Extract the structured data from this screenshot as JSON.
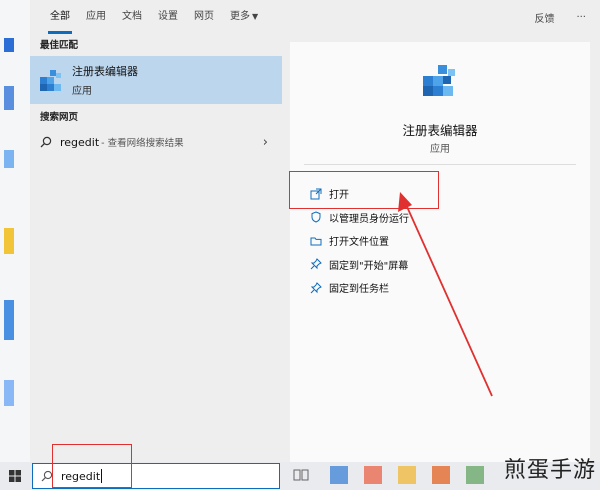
{
  "tabs": [
    {
      "label": "全部",
      "active": true
    },
    {
      "label": "应用"
    },
    {
      "label": "文档"
    },
    {
      "label": "设置"
    },
    {
      "label": "网页"
    },
    {
      "label": "更多"
    }
  ],
  "header_right": {
    "feedback": "反馈",
    "more": "···"
  },
  "best_match": {
    "section": "最佳匹配",
    "title": "注册表编辑器",
    "kind": "应用"
  },
  "web_search": {
    "section": "搜索网页",
    "query": "regedit",
    "suffix": "- 查看网络搜索结果"
  },
  "detail": {
    "title": "注册表编辑器",
    "kind": "应用"
  },
  "actions": [
    {
      "label": "打开",
      "icon": "open-icon"
    },
    {
      "label": "以管理员身份运行",
      "icon": "shield-icon"
    },
    {
      "label": "打开文件位置",
      "icon": "folder-icon"
    },
    {
      "label": "固定到\"开始\"屏幕",
      "icon": "pin-icon"
    },
    {
      "label": "固定到任务栏",
      "icon": "pin-icon"
    }
  ],
  "taskbar": {
    "search_value": "regedit"
  },
  "watermark": "煎蛋手游",
  "colors": {
    "accent": "#0f6cbd",
    "selection": "#bcd6ee",
    "annotation": "#e03030"
  }
}
